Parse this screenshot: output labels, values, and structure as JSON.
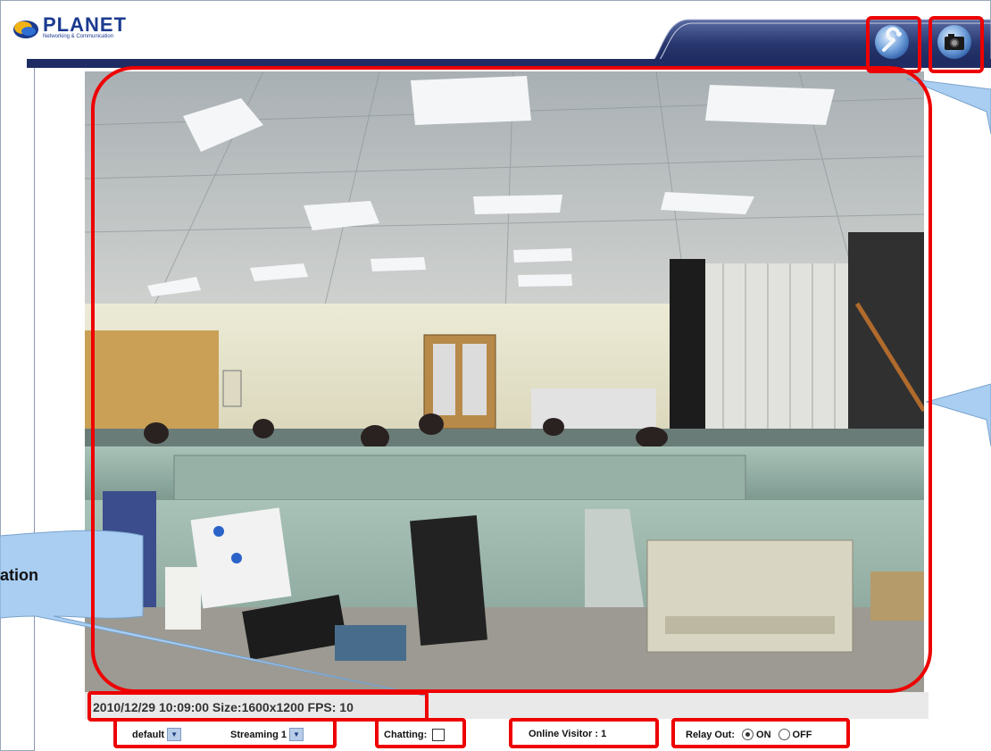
{
  "brand": {
    "name": "PLANET",
    "tagline": "Networking & Communication"
  },
  "toolbar": {
    "settings_icon": "wrench-icon",
    "snapshot_icon": "camera-icon"
  },
  "video": {
    "status_text": "2010/12/29 10:09:00 Size:1600x1200 FPS: 10"
  },
  "controls": {
    "profile_select": "default",
    "stream_select": "Streaming 1",
    "chatting_label": "Chatting:",
    "online_visitor": "Online Visitor : 1",
    "relay_label": "Relay Out:",
    "relay_on": "ON",
    "relay_off": "OFF"
  },
  "callout": {
    "text": "ation"
  },
  "colors": {
    "highlight": "#ee0000",
    "callout_fill": "#a9cef2",
    "header": "#1f2c63"
  }
}
